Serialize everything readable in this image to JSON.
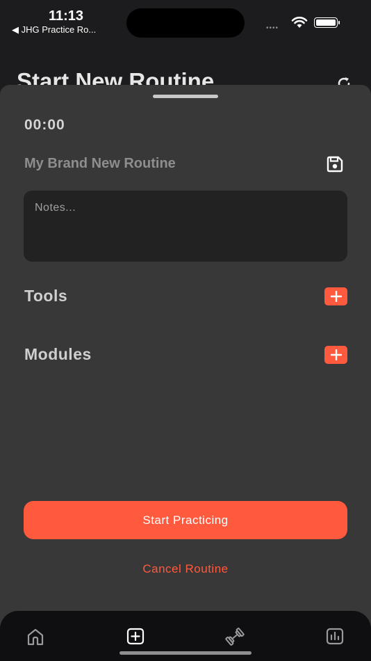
{
  "status_bar": {
    "time": "11:13",
    "back_label": "◀ JHG Practice Ro...",
    "signal": "••••"
  },
  "background_page": {
    "title": "Start New Routine"
  },
  "sheet": {
    "timer": "00:00",
    "routine_name": "My Brand New Routine",
    "notes": {
      "value": "",
      "placeholder": "Notes..."
    },
    "sections": [
      {
        "label": "Tools"
      },
      {
        "label": "Modules"
      }
    ],
    "primary_button_label": "Start Practicing",
    "cancel_label": "Cancel Routine"
  },
  "tabbar": {
    "items": [
      {
        "icon": "home-icon"
      },
      {
        "icon": "add-square-icon"
      },
      {
        "icon": "dumbbell-icon"
      },
      {
        "icon": "chart-icon"
      }
    ]
  },
  "colors": {
    "accent": "#ff5a3d",
    "sheet_bg": "#383838",
    "notes_bg": "#222222",
    "tabbar_bg": "#0f0f12"
  }
}
